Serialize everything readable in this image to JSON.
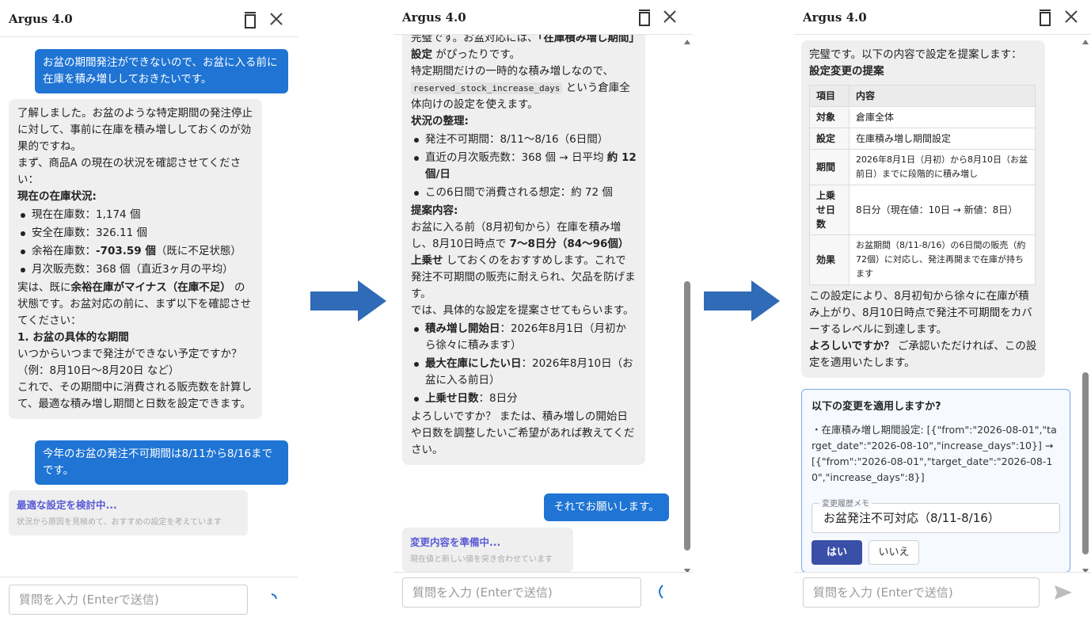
{
  "app": {
    "title": "Argus 4.0"
  },
  "input_placeholder": "質問を入力 (Enterで送信)",
  "panel1": {
    "user1": "お盆の期間発注ができないので、お盆に入る前に在庫を積み増ししておきたいです。",
    "bot1": {
      "p1": "了解しました。お盆のような特定期間の発注停止に対して、事前に在庫を積み増ししておくのが効果的ですね。",
      "p2": "まず、商品A の現在の状況を確認させてください：",
      "h1": "現在の在庫状況:",
      "items": [
        {
          "label": "現在在庫数：",
          "value": "1,174 個",
          "bold": "",
          "after": ""
        },
        {
          "label": "安全在庫数：",
          "value": "326.11 個",
          "bold": "",
          "after": ""
        },
        {
          "label": "余裕在庫数：",
          "value": "",
          "bold": "-703.59 個",
          "after": "（既に不足状態）"
        },
        {
          "label": "月次販売数：",
          "value": "368 個（直近3ヶ月の平均）",
          "bold": "",
          "after": ""
        }
      ],
      "p3a": "実は、既に",
      "p3b": "余裕在庫がマイナス（在庫不足）",
      "p3c": " の状態です。お盆対応の前に、まず以下を確認させてください：",
      "h2": "1. お盆の具体的な期間",
      "p4": "いつからいつまで発注ができない予定ですか？（例：8月10日〜8月20日 など）",
      "p5": "これで、その期間中に消費される販売数を計算して、最適な積み増し期間と日数を設定できます。"
    },
    "user2": "今年のお盆の発注不可期間は8/11から8/16までです。",
    "status_title": "最適な設定を検討中...",
    "status_sub": "状況から原因を見極めて、おすすめの設定を考えています"
  },
  "panel2": {
    "p0a": "完璧です。お盆対応には、",
    "p0b": "「在庫積み増し期間」設定",
    "p0c": " がぴったりです。",
    "p1a": "特定期間だけの一時的な積み増しなので、",
    "p1code": "reserved_stock_increase_days",
    "p1b": " という倉庫全体向けの設定を使えます。",
    "h1": "状況の整理:",
    "items1": [
      {
        "text": "発注不可期間：8/11〜8/16（6日間）",
        "bold": ""
      },
      {
        "text": "直近の月次販売数：368 個 → 日平均 ",
        "bold": "約 12 個/日"
      },
      {
        "text": "この6日間で消費される想定：約 72 個",
        "bold": ""
      }
    ],
    "h2": "提案内容:",
    "p2a": "お盆に入る前（8月初旬から）在庫を積み増し、8月10日時点で ",
    "p2b": "7〜8日分（84〜96個）上乗せ",
    "p2c": " しておくのをおすすめします。これで発注不可期間の販売に耐えられ、欠品を防げます。",
    "p3": "では、具体的な設定を提案させてもらいます。",
    "items2": [
      {
        "bold": "積み増し開始日",
        "text": "：2026年8月1日（月初から徐々に積みます）"
      },
      {
        "bold": "最大在庫にしたい日",
        "text": "：2026年8月10日（お盆に入る前日）"
      },
      {
        "bold": "上乗せ日数",
        "text": "：8日分"
      }
    ],
    "p4": "よろしいですか？ または、積み増しの開始日や日数を調整したいご希望があれば教えてください。",
    "user": "それでお願いします。",
    "status_title": "変更内容を準備中...",
    "status_sub": "現在値と新しい値を突き合わせています"
  },
  "panel3": {
    "p0": "完璧です。以下の内容で設定を提案します：",
    "h1": "設定変更の提案",
    "table_headers": [
      "項目",
      "内容"
    ],
    "table_rows": [
      {
        "k": "対象",
        "v": "倉庫全体"
      },
      {
        "k": "設定",
        "v": "在庫積み増し期間設定"
      },
      {
        "k": "期間",
        "v": "2026年8月1日（月初）から8月10日（お盆前日）までに段階的に積み増し"
      },
      {
        "k": "上乗せ日数",
        "v": "8日分（現在値：10日 → 新値：8日）"
      },
      {
        "k": "効果",
        "v": "お盆期間（8/11-8/16）の6日間の販売（約72個）に対応し、発注再開まで在庫が持ちます"
      }
    ],
    "p1": "この設定により、8月初旬から徐々に在庫が積み上がり、8月10日時点で発注不可期間をカバーするレベルに到達します。",
    "p2a": "よろしいですか？",
    "p2b": " ご承認いただければ、この設定を適用いたします。",
    "confirm": {
      "title": "以下の変更を適用しますか?",
      "body": "・在庫積み増し期間設定: [{\"from\":\"2026-08-01\",\"target_date\":\"2026-08-10\",\"increase_days\":10}] → [{\"from\":\"2026-08-01\",\"target_date\":\"2026-08-10\",\"increase_days\":8}]",
      "memo_label": "変更履歴メモ",
      "memo_value": "お盆発注不可対応（8/11-8/16）",
      "yes": "はい",
      "no": "いいえ"
    }
  },
  "colors": {
    "user_bubble": "#1f74d4",
    "arrow": "#2f6bb6",
    "status_title": "#5a5ad6",
    "yes_button": "#3a4fa8"
  }
}
